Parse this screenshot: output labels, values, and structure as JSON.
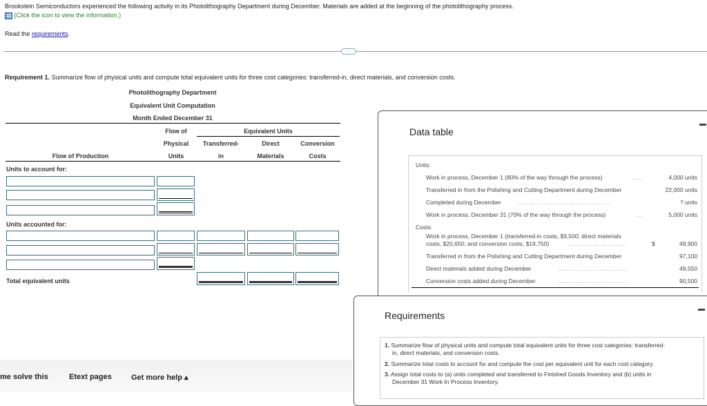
{
  "intro": {
    "text": "Brookstein Semiconductors experienced the following activity in its Photolithography Department during December. Materials are added at the beginning of the photolithography process.",
    "icon_link": "(Click the icon to view the information.)",
    "read_prefix": "Read the ",
    "requirements_link": "requirements",
    "read_suffix": "."
  },
  "expand_button": "···",
  "requirement1": {
    "label": "Requirement 1.",
    "text": " Summarize flow of physical units and compute total equivalent units for three cost categories: transferred-in, direct materials, and conversion costs."
  },
  "schedule": {
    "title1": "Photolithography Department",
    "title2": "Equivalent Unit Computation",
    "title3": "Month Ended December 31",
    "col_flow_of_production": "Flow of Production",
    "col_physical": [
      "Flow of",
      "Physical",
      "Units"
    ],
    "equivalent_units": "Equivalent Units",
    "col_ti": [
      "Transferred-",
      "in"
    ],
    "col_dm": [
      "Direct",
      "Materials"
    ],
    "col_cc": [
      "Conversion",
      "Costs"
    ],
    "units_to_account_for": "Units to account for:",
    "units_accounted_for": "Units accounted for:",
    "total_equivalent_units": "Total equivalent units"
  },
  "data_table": {
    "title": "Data table",
    "units_label": "Units:",
    "units": [
      {
        "label": "Work in process, December 1 (80% of the way through the process)",
        "value": "4,000 units"
      },
      {
        "label": "Transferred in from the Polishing and Cutting Department during December",
        "value": "22,000 units"
      },
      {
        "label": "Completed during December",
        "value": "? units"
      },
      {
        "label": "Work in process, December 31 (70% of the way through the process)",
        "value": "5,000 units"
      }
    ],
    "costs_label": "Costs:",
    "costs": [
      {
        "label1": "Work in process, December 1 (transferred-in costs, $9,500; direct materials",
        "label2": "costs, $20,650; and conversion costs, $19,750)",
        "currency": "$",
        "value": "49,900"
      },
      {
        "label": "Transferred in from the Polishing and Cutting Department during December",
        "value": "97,100"
      },
      {
        "label": "Direct materials added during December",
        "value": "49,550"
      },
      {
        "label": "Conversion costs added during December",
        "value": "90,500"
      }
    ]
  },
  "requirements_panel": {
    "title": "Requirements",
    "items": [
      {
        "num": "1.",
        "line1": "Summarize flow of physical units and compute total equivalent units for three cost categories: transferred-",
        "line2": "in, direct materials, and conversion costs."
      },
      {
        "num": "2.",
        "line1": "Summarize total costs to account for and compute the cost per equivalent unit for each cost category."
      },
      {
        "num": "3.",
        "line1": "Assign total costs to (a) units completed and transferred to Finished Goods Inventory and (b) units in",
        "line2": "December 31 Work In Process Inventory."
      }
    ]
  },
  "bottom_bar": {
    "help_solve": "me solve this",
    "etext": "Etext pages",
    "more_help": "Get more help ▴"
  }
}
